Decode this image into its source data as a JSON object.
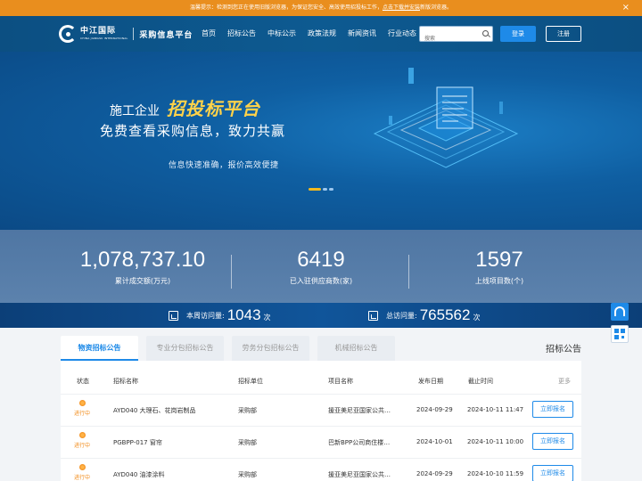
{
  "notice": {
    "text": "温馨提示：检测到您正在使用旧版浏览器，为保证您安全、高效使用招投标工作，",
    "link": "点击下载并安装",
    "suffix": "新版浏览器。",
    "close": "×"
  },
  "header": {
    "logo_cn": "中江国际",
    "logo_en": "CHINA JIANGSU INTERNATIONAL",
    "site_title": "采购信息平台",
    "nav": [
      "首页",
      "招标公告",
      "中标公示",
      "政策法规",
      "新闻资讯",
      "行业动态"
    ],
    "search_placeholder": "搜索",
    "login": "登录",
    "register": "注册"
  },
  "banner": {
    "line1_prefix": "施工企业",
    "line1_highlight": "招投标平台",
    "line2": "免费查看采购信息，致力共赢",
    "line3": "信息快速准确，报价高效便捷",
    "slides": 3,
    "active_slide": 1
  },
  "stats": [
    {
      "value": "1,078,737.10",
      "label": "累计成交额(万元)"
    },
    {
      "value": "6419",
      "label": "已入驻供应商数(家)"
    },
    {
      "value": "1597",
      "label": "上线项目数(个)"
    }
  ],
  "visits": [
    {
      "label": "本周访问量:",
      "value": "1043",
      "unit": "次"
    },
    {
      "label": "总访问量:",
      "value": "765562",
      "unit": "次"
    }
  ],
  "section": {
    "title": "招标公告",
    "tabs": [
      "物资招标公告",
      "专业分包招标公告",
      "劳务分包招标公告",
      "机械招标公告"
    ],
    "active_tab": 0,
    "columns": {
      "status": "状态",
      "name": "招标名称",
      "unit": "招标单位",
      "project": "项目名称",
      "publish": "发布日期",
      "deadline": "截止时间",
      "more": "更多"
    },
    "rows": [
      {
        "status": "进行中",
        "name": "AYD040 大理石、花岗岩制品",
        "unit": "采购部",
        "project": "援亚美尼亚国家公共…",
        "publish": "2024-09-29",
        "deadline": "2024-10-11 11:47",
        "action": "立即报名"
      },
      {
        "status": "进行中",
        "name": "PGBPP-017 窗帘",
        "unit": "采购部",
        "project": "巴新BPP公司商住楼…",
        "publish": "2024-10-01",
        "deadline": "2024-10-11 10:00",
        "action": "立即报名"
      },
      {
        "status": "进行中",
        "name": "AYD040 油漆涂料",
        "unit": "采购部",
        "project": "援亚美尼亚国家公共…",
        "publish": "2024-09-29",
        "deadline": "2024-10-10 11:59",
        "action": "立即报名"
      }
    ]
  },
  "colors": {
    "notice_bg": "#e98e1e",
    "header_bg": "#0d5a91",
    "accent": "#1e8ae8",
    "highlight": "#ffd24a",
    "status": "#f28c1b"
  },
  "icons": [
    "close-icon",
    "logo-icon",
    "search-icon",
    "visit-icon",
    "headset-icon",
    "qr-code-icon",
    "status-icon"
  ]
}
